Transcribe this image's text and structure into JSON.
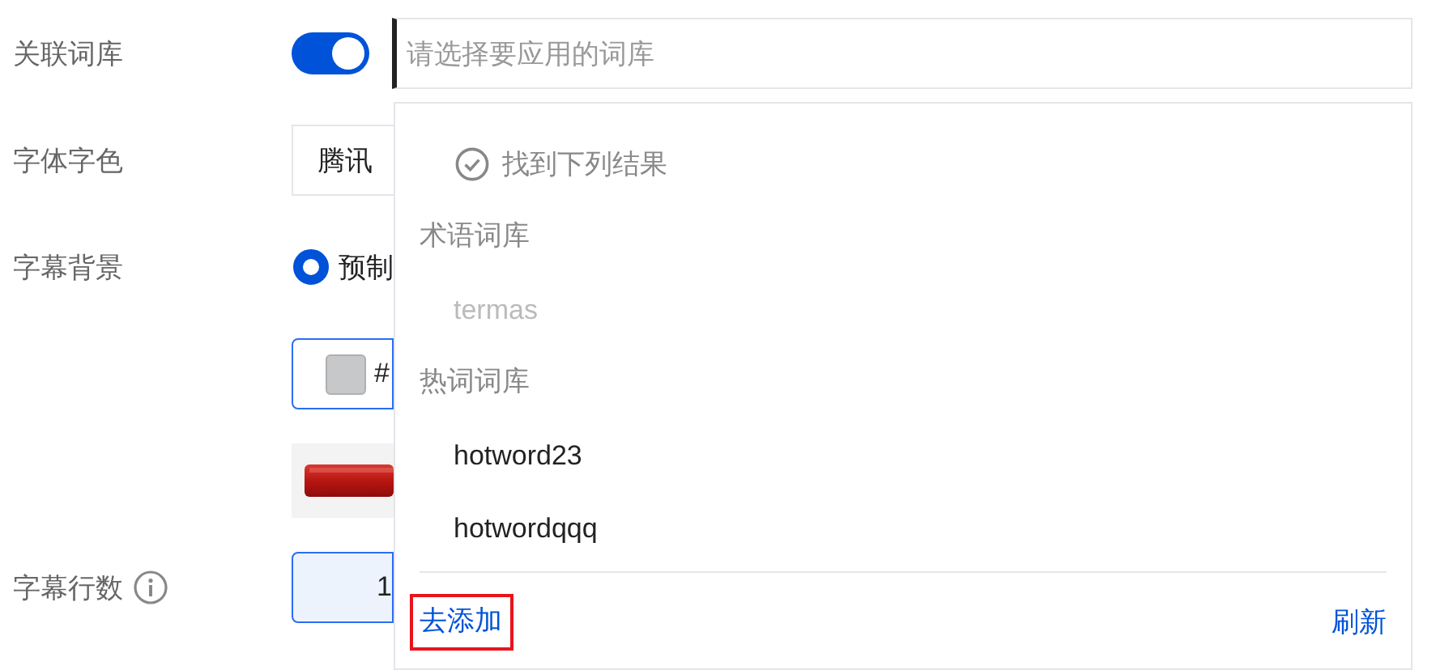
{
  "form_rows": [
    {
      "kind": "switch",
      "label": "关联词库",
      "on": true,
      "search": {
        "placeholder": "请选择要应用的词库",
        "focused": true
      }
    },
    {
      "kind": "select",
      "label": "字体字色",
      "value": "腾讯"
    },
    {
      "kind": "radio",
      "label": "字幕背景",
      "option": "预制",
      "selected": true
    },
    {
      "kind": "color",
      "value": "#"
    },
    {
      "kind": "preview"
    },
    {
      "kind": "number",
      "label": "字幕行数",
      "hint_icon": true,
      "value": "1"
    }
  ],
  "dropdown": {
    "status": "找到下列结果",
    "groups": [
      {
        "title": "术语词库",
        "items": [
          {
            "label": "termas",
            "disabled": true
          }
        ]
      },
      {
        "title": "热词词库",
        "items": [
          {
            "label": "hotword23",
            "disabled": false
          },
          {
            "label": "hotwordqqq",
            "disabled": false
          }
        ]
      }
    ],
    "add_link": {
      "label": "去添加",
      "highlighted": true
    },
    "refresh_link": "刷新"
  }
}
